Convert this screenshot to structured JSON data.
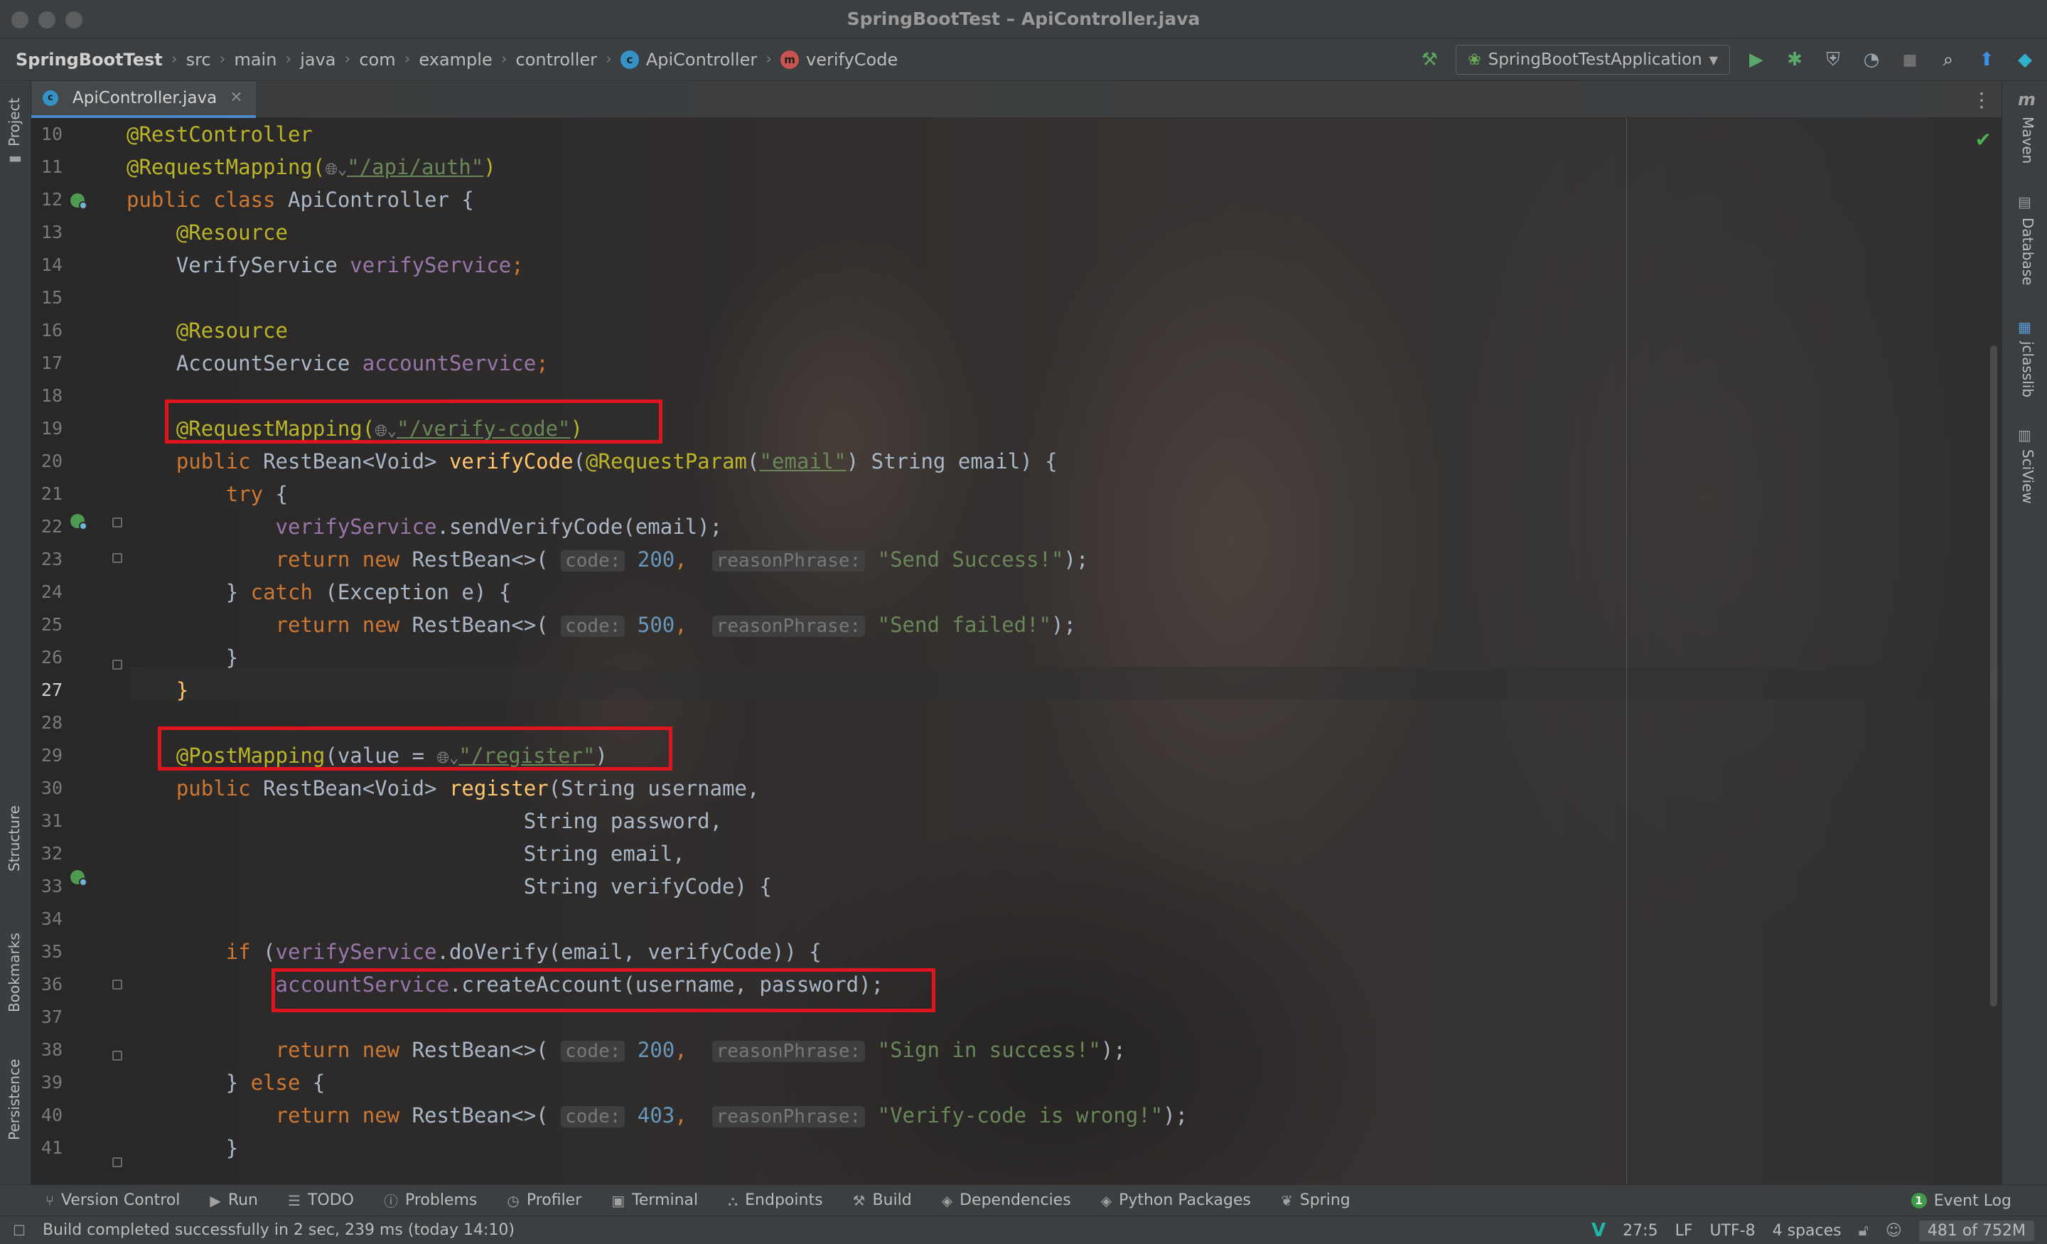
{
  "window": {
    "title": "SpringBootTest – ApiController.java"
  },
  "breadcrumbs": [
    {
      "label": "SpringBootTest"
    },
    {
      "label": "src"
    },
    {
      "label": "main"
    },
    {
      "label": "java"
    },
    {
      "label": "com"
    },
    {
      "label": "example"
    },
    {
      "label": "controller"
    },
    {
      "label": "ApiController"
    },
    {
      "label": "verifyCode"
    }
  ],
  "run_config": {
    "label": "SpringBootTestApplication"
  },
  "tabs": [
    {
      "label": "ApiController.java",
      "active": true
    }
  ],
  "left_tools": {
    "project": "Project",
    "structure": "Structure",
    "bookmarks": "Bookmarks",
    "persistence": "Persistence"
  },
  "right_tools": {
    "maven": "Maven",
    "database": "Database",
    "jclasslib": "jclasslib",
    "sciview": "SciView"
  },
  "editor": {
    "current_line": 27,
    "line_numbers": [
      "10",
      "11",
      "12",
      "13",
      "14",
      "15",
      "16",
      "17",
      "18",
      "19",
      "20",
      "21",
      "22",
      "23",
      "24",
      "25",
      "26",
      "27",
      "28",
      "29",
      "30",
      "31",
      "32",
      "33",
      "34",
      "35",
      "36",
      "37",
      "38",
      "39",
      "40",
      "41"
    ],
    "code": {
      "l10_ann": "@RestController",
      "l11_ann": "@RequestMapping(",
      "l11_str": "\"/api/auth\"",
      "l11_end": ")",
      "l12_kw": "public class ",
      "l12_name": "ApiController {",
      "l13": "@Resource",
      "l14_type": "VerifyService ",
      "l14_field": "verifyService",
      "l14_end": ";",
      "l16": "@Resource",
      "l17_type": "AccountService ",
      "l17_field": "accountService",
      "l17_end": ";",
      "l19_ann": "@RequestMapping(",
      "l19_str": "\"/verify-code\"",
      "l19_end": ")",
      "l20_kw": "public ",
      "l20_type": "RestBean<Void> ",
      "l20_mth": "verifyCode",
      "l20_p1": "(",
      "l20_ann": "@RequestParam",
      "l20_p2": "(",
      "l20_str": "\"email\"",
      "l20_p3": ") String email) {",
      "l21_kw": "try",
      "l21_end": " {",
      "l22_field": "verifyService",
      "l22_end": ".sendVerifyCode(email);",
      "l23_kw": "return new ",
      "l23_a": "RestBean<>(",
      "hint_code": "code:",
      "l23_num": "200",
      "comma": ",",
      "hint_reason": "reasonPhrase:",
      "l23_str": "\"Send Success!\"",
      "l23_end": ");",
      "l24_a": "} ",
      "l24_kw": "catch",
      "l24_b": " (Exception e) {",
      "l25_kw": "return new ",
      "l25_a": "RestBean<>(",
      "l25_num": "500",
      "l25_str": "\"Send failed!\"",
      "l25_end": ");",
      "l26": "}",
      "l27": "}",
      "l29_ann": "@PostMapping",
      "l29_a": "(value = ",
      "l29_str": "\"/register\"",
      "l29_end": ")",
      "l30_kw": "public ",
      "l30_type": "RestBean<Void> ",
      "l30_mth": "register",
      "l30_rest": "(String username,",
      "l31": "String password,",
      "l32": "String email,",
      "l33": "String verifyCode) {",
      "l35_kw": "if",
      "l35_a": " (",
      "l35_field": "verifyService",
      "l35_b": ".doVerify(email, verifyCode)) {",
      "l36_field": "accountService",
      "l36_b": ".createAccount(username, password);",
      "l38_kw": "return new ",
      "l38_a": "RestBean<>(",
      "l38_num": "200",
      "l38_str": "\"Sign in success!\"",
      "l38_end": ");",
      "l39_a": "} ",
      "l39_kw": "else",
      "l39_b": " {",
      "l40_kw": "return new ",
      "l40_a": "RestBean<>(",
      "l40_num": "403",
      "l40_str": "\"Verify-code is wrong!\"",
      "l40_end": ");",
      "l41": "}"
    }
  },
  "tool_windows": [
    "Version Control",
    "Run",
    "TODO",
    "Problems",
    "Profiler",
    "Terminal",
    "Endpoints",
    "Build",
    "Dependencies",
    "Python Packages",
    "Spring"
  ],
  "event_log": {
    "count": "1",
    "label": "Event Log"
  },
  "status": {
    "message": "Build completed successfully in 2 sec, 239 ms (today 14:10)",
    "position": "27:5",
    "line_sep": "LF",
    "encoding": "UTF-8",
    "indent": "4 spaces",
    "memory": "481 of 752M"
  },
  "colors": {
    "annotation": "#bbb529",
    "keyword": "#cc7832",
    "string": "#6a8759",
    "field": "#9876aa",
    "method": "#ffc66d",
    "number": "#6897bb",
    "highlight_box": "#e0141e"
  },
  "icons": [
    "build-hammer-icon",
    "run-icon",
    "debug-icon",
    "coverage-icon",
    "profile-icon",
    "stop-icon",
    "search-icon",
    "update-icon",
    "plugin-icon",
    "class-icon",
    "method-icon",
    "spring-bean-icon",
    "check-icon"
  ]
}
